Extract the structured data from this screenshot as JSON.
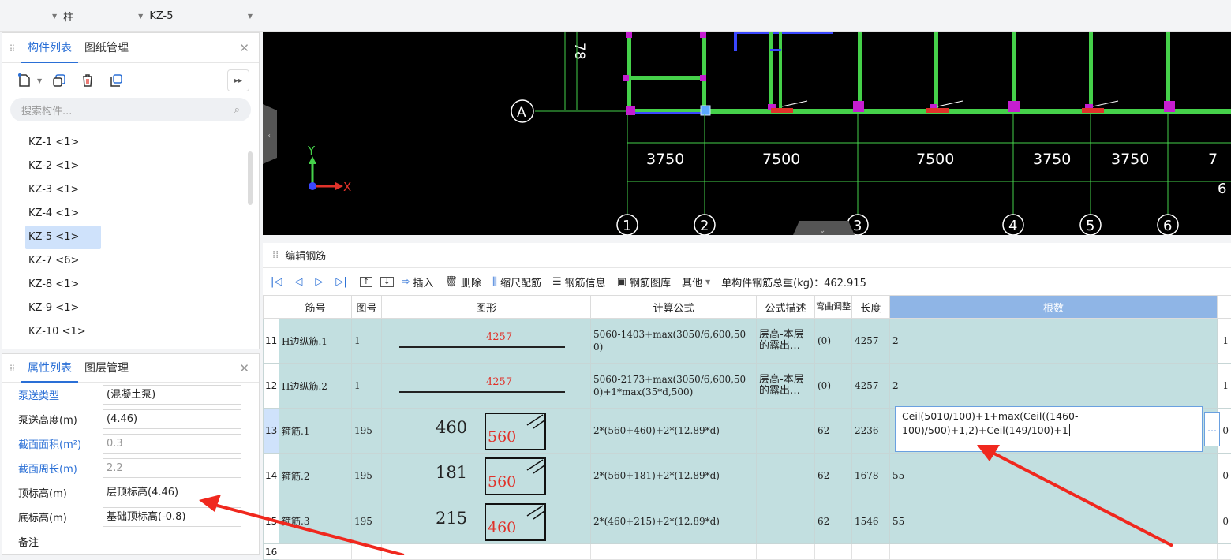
{
  "topbar": {
    "type_value": "柱",
    "component_value": "KZ-5"
  },
  "component_panel": {
    "tabs": [
      "构件列表",
      "图纸管理"
    ],
    "search_placeholder": "搜索构件...",
    "items": [
      "KZ-1 <1>",
      "KZ-2 <1>",
      "KZ-3 <1>",
      "KZ-4 <1>",
      "KZ-5 <1>",
      "KZ-7 <6>",
      "KZ-8 <1>",
      "KZ-9 <1>",
      "KZ-10 <1>"
    ],
    "selected_index": 4
  },
  "property_panel": {
    "tabs": [
      "属性列表",
      "图层管理"
    ],
    "rows": [
      {
        "label": "泵送类型",
        "value": "(混凝土泵)",
        "blue": true
      },
      {
        "label": "泵送高度(m)",
        "value": "(4.46)",
        "blue": false
      },
      {
        "label": "截面面积(m²)",
        "value": "0.3",
        "blue": true,
        "gray": true
      },
      {
        "label": "截面周长(m)",
        "value": "2.2",
        "blue": true,
        "gray": true
      },
      {
        "label": "顶标高(m)",
        "value": "层顶标高(4.46)",
        "blue": false
      },
      {
        "label": "底标高(m)",
        "value": "基础顶标高(-0.8)",
        "blue": false
      },
      {
        "label": "备注",
        "value": "",
        "blue": false
      }
    ]
  },
  "cad": {
    "axis_letter": "A",
    "top_dim": "78",
    "dims": [
      "3750",
      "7500",
      "7500",
      "3750",
      "3750",
      "7"
    ],
    "second_dim": "6",
    "axes": [
      "1",
      "2",
      "3",
      "4",
      "5",
      "6"
    ],
    "x_label": "X",
    "y_label": "Y",
    "colors": {
      "green": "#45d14a",
      "purple": "#c51ed0",
      "blue": "#3a47ff",
      "red": "#e0322a"
    }
  },
  "editor": {
    "title": "编辑钢筋",
    "toolbar": {
      "insert": "插入",
      "delete": "删除",
      "scale": "缩尺配筋",
      "info": "钢筋信息",
      "library": "钢筋图库",
      "other": "其他",
      "total": "单构件钢筋总重(kg)：462.915"
    },
    "headers": [
      "筋号",
      "图号",
      "图形",
      "计算公式",
      "公式描述",
      "弯曲调整",
      "长度",
      "根数"
    ],
    "rows": [
      {
        "no": "11",
        "name": "H边纵筋.1",
        "fig": "1",
        "shape": "4257",
        "formula": "5060-1403+max(3050/6,600,500)",
        "desc": "层高-本层的露出…",
        "adj": "(0)",
        "len": "4257",
        "count": "2",
        "tail": "1"
      },
      {
        "no": "12",
        "name": "H边纵筋.2",
        "fig": "1",
        "shape": "4257",
        "formula": "5060-2173+max(3050/6,600,500)+1*max(35*d,500)",
        "desc": "层高-本层的露出…",
        "adj": "(0)",
        "len": "4257",
        "count": "2",
        "tail": "1"
      },
      {
        "no": "13",
        "name": "箍筋.1",
        "fig": "195",
        "shape_a": "460",
        "shape_b": "560",
        "formula": "2*(560+460)+2*(12.89*d)",
        "desc": "",
        "adj": "62",
        "len": "2236",
        "count": "Ceil(5010/100)+1+max(Ceil((1460-100)/500)+1,2)+Ceil(149/100)+1",
        "tail": "0"
      },
      {
        "no": "14",
        "name": "箍筋.2",
        "fig": "195",
        "shape_a": "181",
        "shape_b": "560",
        "formula": "2*(560+181)+2*(12.89*d)",
        "desc": "",
        "adj": "62",
        "len": "1678",
        "count": "55",
        "tail": "0"
      },
      {
        "no": "15",
        "name": "箍筋.3",
        "fig": "195",
        "shape_a": "215",
        "shape_b": "460",
        "formula": "2*(460+215)+2*(12.89*d)",
        "desc": "",
        "adj": "62",
        "len": "1546",
        "count": "55",
        "tail": "0"
      },
      {
        "no": "16"
      }
    ]
  }
}
